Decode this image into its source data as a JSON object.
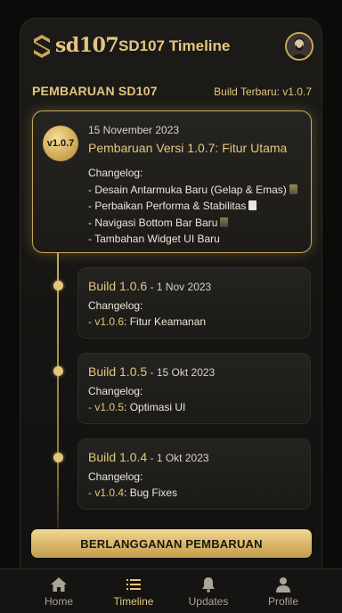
{
  "header": {
    "logo_text": "sd107",
    "app_title": "SD107 Timeline"
  },
  "section": {
    "title": "PEMBARUAN SD107",
    "latest_build": "Build Terbaru: v1.0.7"
  },
  "featured": {
    "badge": "v1.0.7",
    "date": "15 November 2023",
    "title": "Pembaruan Versi 1.0.7: Fitur Utama",
    "changelog_label": "Changelog:",
    "items": [
      "- Desain Antarmuka Baru (Gelap & Emas)",
      "- Perbaikan Performa & Stabilitas",
      "- Navigasi Bottom Bar Baru",
      "- Tambahan Widget UI Baru"
    ]
  },
  "builds": [
    {
      "title": "Build 1.0.6",
      "date": " - 1 Nov 2023",
      "changelog_label": "Changelog:",
      "version": "- v1.0.6",
      "note": ": Fitur Keamanan"
    },
    {
      "title": "Build 1.0.5",
      "date": " - 15 Okt 2023",
      "changelog_label": "Changelog:",
      "version": "- v1.0.5",
      "note": ": Optimasi UI"
    },
    {
      "title": "Build 1.0.4",
      "date": " - 1 Okt 2023",
      "changelog_label": "Changelog:",
      "version": "- v1.0.4",
      "note": ": Bug Fixes"
    }
  ],
  "subscribe_label": "BERLANGGANAN PEMBARUAN",
  "nav": [
    {
      "label": "Home",
      "icon": "home-icon"
    },
    {
      "label": "Timeline",
      "icon": "list-icon",
      "active": true
    },
    {
      "label": "Updates",
      "icon": "bell-icon"
    },
    {
      "label": "Profile",
      "icon": "person-icon"
    }
  ],
  "colors": {
    "accent_gold": "#e3c77e",
    "background": "#0c0b09",
    "card": "#1c1b18"
  }
}
